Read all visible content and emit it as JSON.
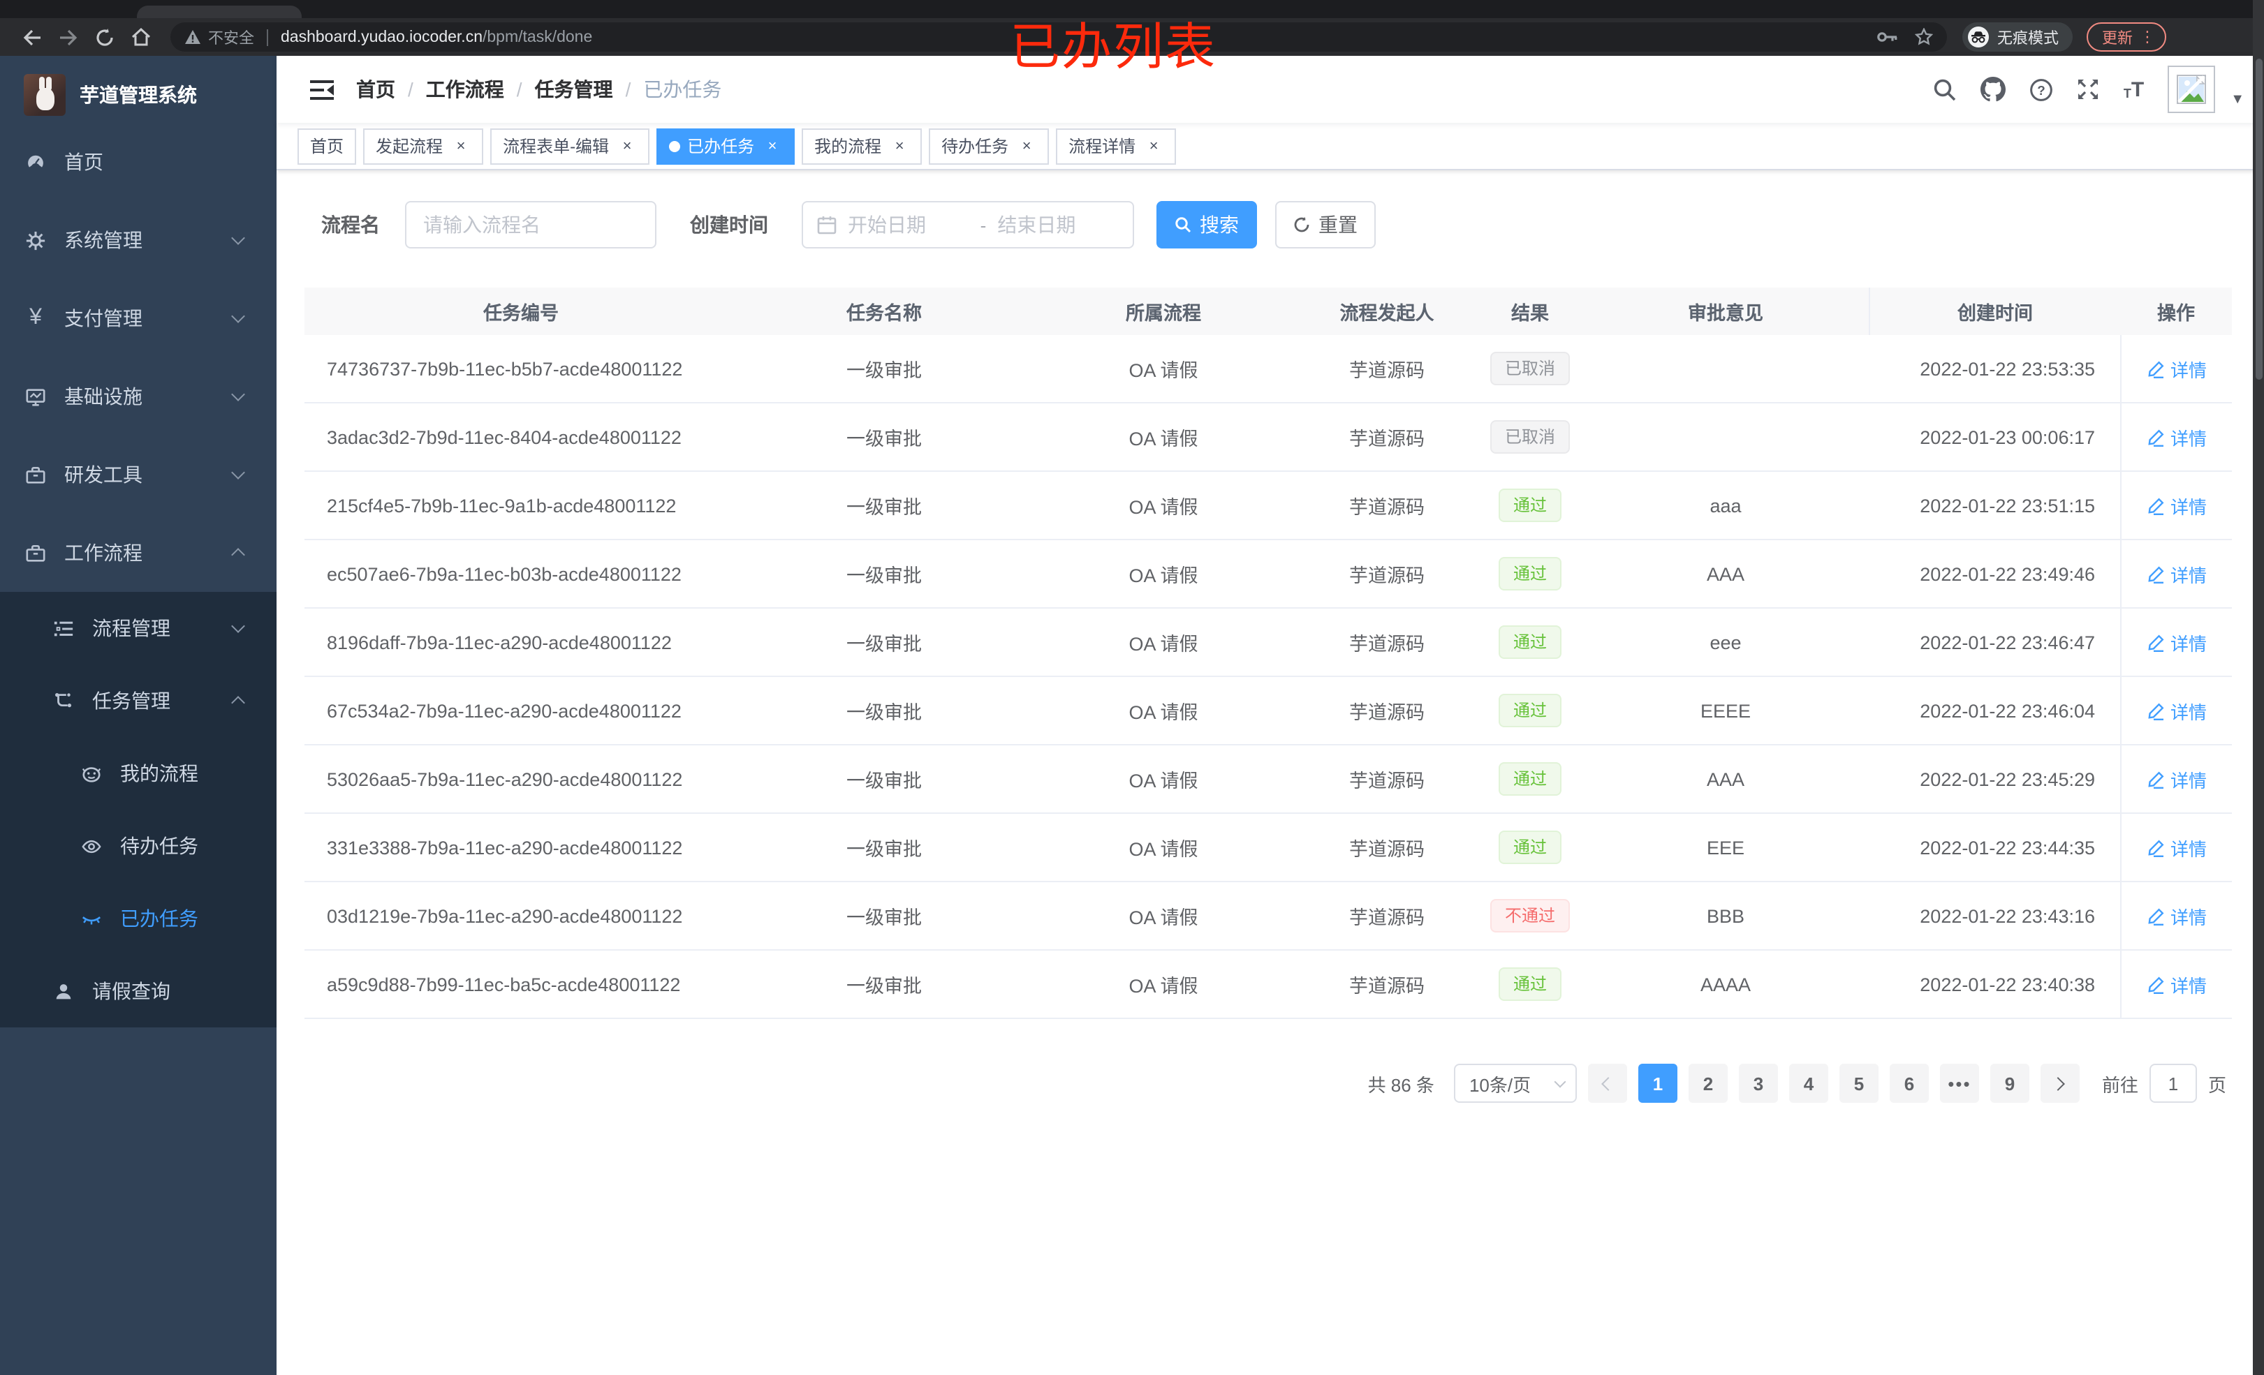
{
  "colors": {
    "accent": "#409eff",
    "success": "#67c23a",
    "danger": "#f56c6c",
    "info": "#909399",
    "annotation_red": "#fc2a0c",
    "sidebar_bg": "#304156",
    "submenu_bg": "#1f2d3d"
  },
  "browser": {
    "security": "不安全",
    "url_host": "dashboard.yudao.iocoder.cn",
    "url_path": "/bpm/task/done",
    "incognito_label": "无痕模式",
    "update_label": "更新"
  },
  "annotation": "已办列表",
  "sidebar": {
    "title": "芋道管理系统",
    "items": [
      {
        "label": "首页"
      },
      {
        "label": "系统管理"
      },
      {
        "label": "支付管理"
      },
      {
        "label": "基础设施"
      },
      {
        "label": "研发工具"
      },
      {
        "label": "工作流程"
      },
      {
        "label": "流程管理"
      },
      {
        "label": "任务管理"
      },
      {
        "label": "我的流程"
      },
      {
        "label": "待办任务"
      },
      {
        "label": "已办任务"
      },
      {
        "label": "请假查询"
      }
    ]
  },
  "navbar": {
    "breadcrumb": [
      "首页",
      "工作流程",
      "任务管理",
      "已办任务"
    ]
  },
  "tags": [
    {
      "label": "首页",
      "closable": false,
      "state": ""
    },
    {
      "label": "发起流程",
      "closable": true,
      "state": ""
    },
    {
      "label": "流程表单-编辑",
      "closable": true,
      "state": ""
    },
    {
      "label": "已办任务",
      "closable": true,
      "state": "active",
      "active": true
    },
    {
      "label": "我的流程",
      "closable": true,
      "state": ""
    },
    {
      "label": "待办任务",
      "closable": true,
      "state": ""
    },
    {
      "label": "流程详情",
      "closable": true,
      "state": ""
    }
  ],
  "filters": {
    "name_label": "流程名",
    "name_placeholder": "请输入流程名",
    "time_label": "创建时间",
    "start_placeholder": "开始日期",
    "range_separator": "-",
    "end_placeholder": "结束日期",
    "search_label": "搜索",
    "reset_label": "重置"
  },
  "table": {
    "headers": [
      "任务编号",
      "任务名称",
      "所属流程",
      "流程发起人",
      "结果",
      "审批意见",
      "创建时间",
      "操作"
    ],
    "action_label": "详情",
    "rows": [
      {
        "id": "74736737-7b9b-11ec-b5b7-acde48001122",
        "name": "一级审批",
        "process": "OA 请假",
        "starter": "芋道源码",
        "result": "已取消",
        "result_type": "badge-info",
        "comment": "",
        "time": "2022-01-22 23:53:35"
      },
      {
        "id": "3adac3d2-7b9d-11ec-8404-acde48001122",
        "name": "一级审批",
        "process": "OA 请假",
        "starter": "芋道源码",
        "result": "已取消",
        "result_type": "badge-info",
        "comment": "",
        "time": "2022-01-23 00:06:17"
      },
      {
        "id": "215cf4e5-7b9b-11ec-9a1b-acde48001122",
        "name": "一级审批",
        "process": "OA 请假",
        "starter": "芋道源码",
        "result": "通过",
        "result_type": "badge-success",
        "comment": "aaa",
        "time": "2022-01-22 23:51:15"
      },
      {
        "id": "ec507ae6-7b9a-11ec-b03b-acde48001122",
        "name": "一级审批",
        "process": "OA 请假",
        "starter": "芋道源码",
        "result": "通过",
        "result_type": "badge-success",
        "comment": "AAA",
        "time": "2022-01-22 23:49:46"
      },
      {
        "id": "8196daff-7b9a-11ec-a290-acde48001122",
        "name": "一级审批",
        "process": "OA 请假",
        "starter": "芋道源码",
        "result": "通过",
        "result_type": "badge-success",
        "comment": "eee",
        "time": "2022-01-22 23:46:47"
      },
      {
        "id": "67c534a2-7b9a-11ec-a290-acde48001122",
        "name": "一级审批",
        "process": "OA 请假",
        "starter": "芋道源码",
        "result": "通过",
        "result_type": "badge-success",
        "comment": "EEEE",
        "time": "2022-01-22 23:46:04"
      },
      {
        "id": "53026aa5-7b9a-11ec-a290-acde48001122",
        "name": "一级审批",
        "process": "OA 请假",
        "starter": "芋道源码",
        "result": "通过",
        "result_type": "badge-success",
        "comment": "AAA",
        "time": "2022-01-22 23:45:29"
      },
      {
        "id": "331e3388-7b9a-11ec-a290-acde48001122",
        "name": "一级审批",
        "process": "OA 请假",
        "starter": "芋道源码",
        "result": "通过",
        "result_type": "badge-success",
        "comment": "EEE",
        "time": "2022-01-22 23:44:35"
      },
      {
        "id": "03d1219e-7b9a-11ec-a290-acde48001122",
        "name": "一级审批",
        "process": "OA 请假",
        "starter": "芋道源码",
        "result": "不通过",
        "result_type": "badge-danger",
        "comment": "BBB",
        "time": "2022-01-22 23:43:16"
      },
      {
        "id": "a59c9d88-7b99-11ec-ba5c-acde48001122",
        "name": "一级审批",
        "process": "OA 请假",
        "starter": "芋道源码",
        "result": "通过",
        "result_type": "badge-success",
        "comment": "AAAA",
        "time": "2022-01-22 23:40:38"
      }
    ]
  },
  "pagination": {
    "total": "共 86 条",
    "page_size": "10条/页",
    "pages": [
      {
        "label": "1",
        "state": "active"
      },
      {
        "label": "2",
        "state": ""
      },
      {
        "label": "3",
        "state": ""
      },
      {
        "label": "4",
        "state": ""
      },
      {
        "label": "5",
        "state": ""
      },
      {
        "label": "6",
        "state": ""
      },
      {
        "label": "•••",
        "state": "ellipsis"
      },
      {
        "label": "9",
        "state": ""
      }
    ],
    "goto_label": "前往",
    "goto_value": "1",
    "page_unit": "页"
  }
}
